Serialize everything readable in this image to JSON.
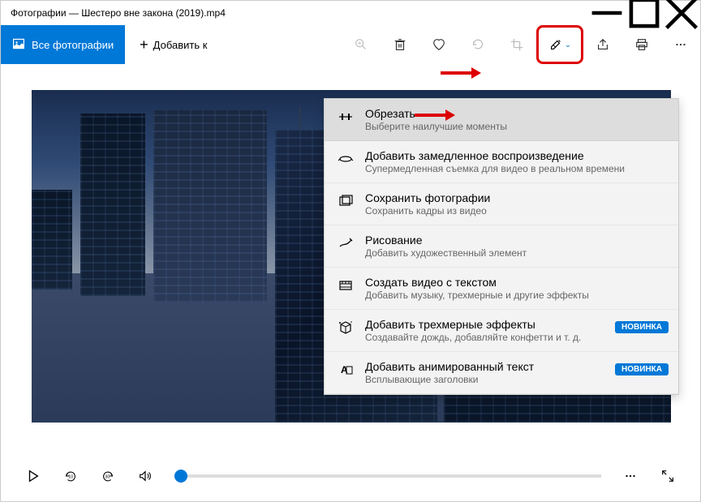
{
  "title": "Фотографии — Шестеро вне закона (2019).mp4",
  "toolbar": {
    "see_all": "Все фотографии",
    "add_to": "Добавить к"
  },
  "dropdown": [
    {
      "icon": "trim",
      "title": "Обрезать",
      "sub": "Выберите наилучшие моменты",
      "highlighted": true
    },
    {
      "icon": "slow",
      "title": "Добавить замедленное воспроизведение",
      "sub": "Супермедленная съемка для видео в реальном времени"
    },
    {
      "icon": "photos",
      "title": "Сохранить фотографии",
      "sub": "Сохранить кадры из видео"
    },
    {
      "icon": "draw",
      "title": "Рисование",
      "sub": "Добавить художественный элемент"
    },
    {
      "icon": "video-text",
      "title": "Создать видео с текстом",
      "sub": "Добавить музыку, трехмерные и другие эффекты"
    },
    {
      "icon": "3d",
      "title": "Добавить трехмерные эффекты",
      "sub": "Создавайте дождь, добавляйте конфетти и т. д.",
      "badge": "НОВИНКА"
    },
    {
      "icon": "anim-text",
      "title": "Добавить анимированный текст",
      "sub": "Всплывающие заголовки",
      "badge": "НОВИНКА"
    }
  ]
}
